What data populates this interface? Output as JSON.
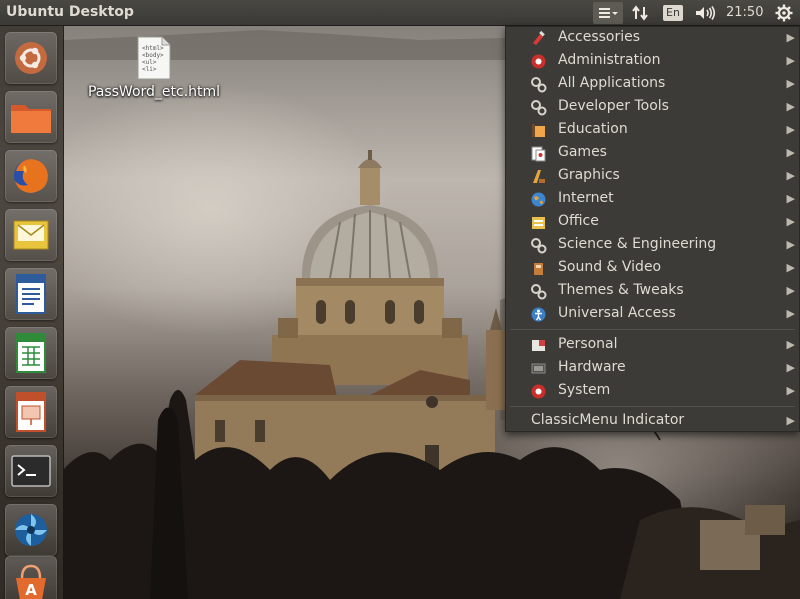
{
  "panel": {
    "title": "Ubuntu Desktop",
    "keyboard_layout": "En",
    "clock": "21:50",
    "tray_icons": [
      "classicmenu-icon",
      "network-icon",
      "keyboard-layout-icon",
      "volume-icon",
      "session-gear-icon"
    ]
  },
  "launcher": {
    "items": [
      {
        "icon": "ubuntu-logo-icon"
      },
      {
        "icon": "files-folder-icon"
      },
      {
        "icon": "firefox-icon"
      },
      {
        "icon": "email-icon"
      },
      {
        "icon": "writer-document-icon"
      },
      {
        "icon": "calc-spreadsheet-icon"
      },
      {
        "icon": "impress-presentation-icon"
      },
      {
        "icon": "terminal-icon"
      },
      {
        "icon": "shutter-icon"
      },
      {
        "icon": "software-center-icon"
      }
    ]
  },
  "desktop": {
    "file_name": "PassWord_etc.html",
    "file_preview_lines": [
      "<html>",
      "<body>",
      "<ul>",
      "<li>"
    ]
  },
  "menu": {
    "categories": [
      {
        "label": "Accessories",
        "icon": "accessories-icon"
      },
      {
        "label": "Administration",
        "icon": "administration-icon"
      },
      {
        "label": "All Applications",
        "icon": "all-applications-icon"
      },
      {
        "label": "Developer Tools",
        "icon": "developer-tools-icon"
      },
      {
        "label": "Education",
        "icon": "education-icon"
      },
      {
        "label": "Games",
        "icon": "games-icon"
      },
      {
        "label": "Graphics",
        "icon": "graphics-icon"
      },
      {
        "label": "Internet",
        "icon": "internet-icon"
      },
      {
        "label": "Office",
        "icon": "office-icon"
      },
      {
        "label": "Science & Engineering",
        "icon": "science-icon"
      },
      {
        "label": "Sound & Video",
        "icon": "sound-video-icon"
      },
      {
        "label": "Themes & Tweaks",
        "icon": "themes-icon"
      },
      {
        "label": "Universal Access",
        "icon": "universal-access-icon"
      }
    ],
    "system": [
      {
        "label": "Personal",
        "icon": "personal-icon"
      },
      {
        "label": "Hardware",
        "icon": "hardware-icon"
      },
      {
        "label": "System",
        "icon": "system-icon"
      }
    ],
    "indicator_label": "ClassicMenu Indicator",
    "submenu_arrow": "▶"
  },
  "colors": {
    "panel_bg": "#3b3935",
    "menu_bg": "#3c3b37",
    "menu_text": "#dfdbd2",
    "launcher_bg": "#342e28"
  }
}
